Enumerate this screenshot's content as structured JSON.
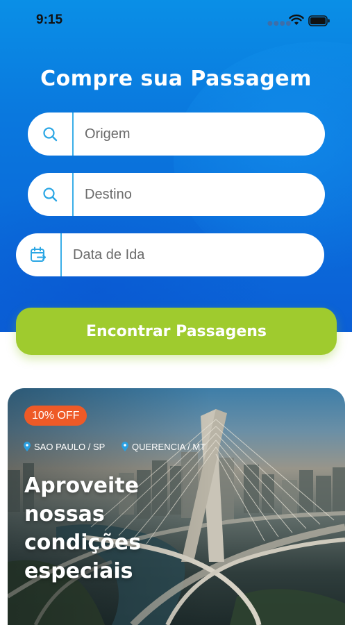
{
  "status_bar": {
    "time": "9:15"
  },
  "header": {
    "title": "Compre sua Passagem"
  },
  "form": {
    "origin_placeholder": "Origem",
    "destination_placeholder": "Destino",
    "date_placeholder": "Data de Ida",
    "submit_label": "Encontrar Passagens"
  },
  "promo": {
    "badge": "10% OFF",
    "from": "SAO PAULO / SP",
    "to": "QUERENCIA / MT",
    "headline_lines": [
      "Aproveite",
      "nossas",
      "condições",
      "especiais"
    ]
  },
  "colors": {
    "primary_blue": "#0a78de",
    "accent_cyan": "#3aaee8",
    "cta_green": "#9fcb2e",
    "badge_orange": "#ee5a27"
  },
  "icons": [
    "search-icon",
    "calendar-icon",
    "location-pin-icon",
    "wifi-icon",
    "battery-icon"
  ]
}
